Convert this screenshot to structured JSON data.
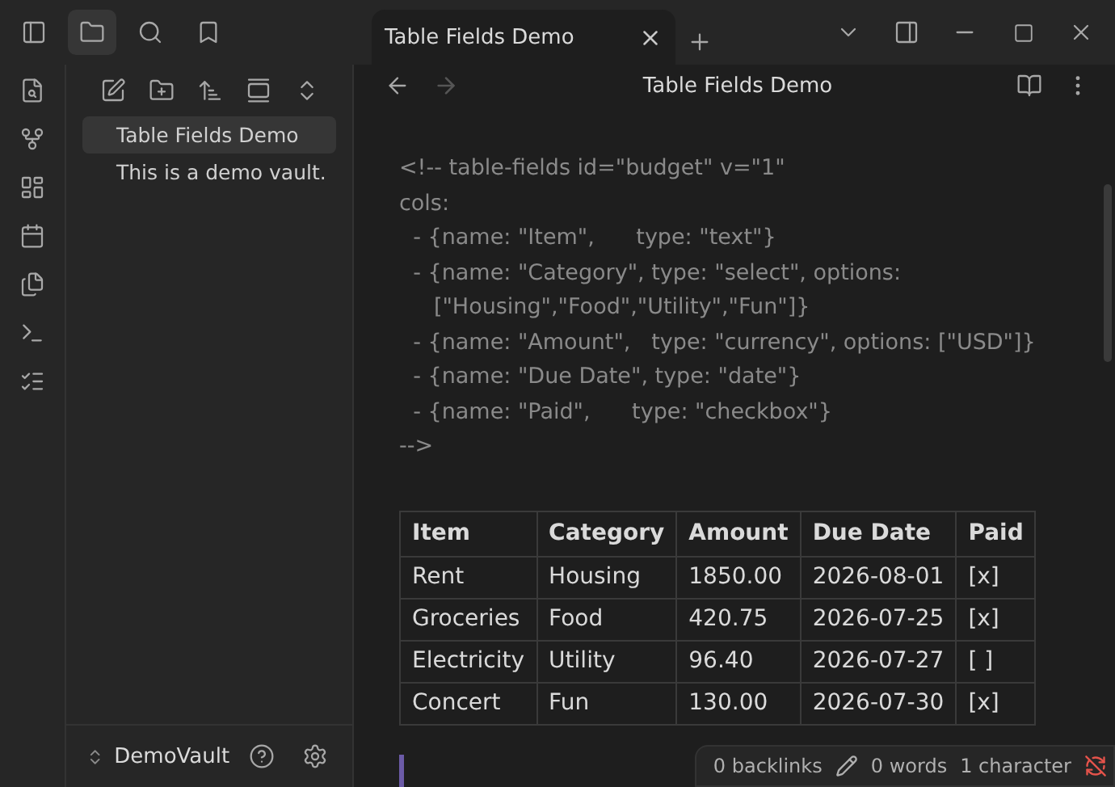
{
  "tab": {
    "title": "Table Fields Demo"
  },
  "file_tree": [
    {
      "label": "Table Fields Demo",
      "selected": true
    },
    {
      "label": "This is a demo vault.",
      "selected": false
    }
  ],
  "vault": {
    "name": "DemoVault"
  },
  "note": {
    "title": "Table Fields Demo",
    "code_lines": [
      "<!-- table-fields id=\"budget\" v=\"1\"",
      "cols:",
      "  - {name: \"Item\",      type: \"text\"}",
      "  - {name: \"Category\", type: \"select\", options:",
      "     [\"Housing\",\"Food\",\"Utility\",\"Fun\"]}",
      "  - {name: \"Amount\",   type: \"currency\", options: [\"USD\"]}",
      "  - {name: \"Due Date\", type: \"date\"}",
      "  - {name: \"Paid\",      type: \"checkbox\"}",
      "-->"
    ],
    "table": {
      "columns": [
        "Item",
        "Category",
        "Amount",
        "Due Date",
        "Paid"
      ],
      "rows": [
        [
          "Rent",
          "Housing",
          "1850.00",
          "2026-08-01",
          "[x]"
        ],
        [
          "Groceries",
          "Food",
          "420.75",
          "2026-07-25",
          "[x]"
        ],
        [
          "Electricity",
          "Utility",
          "96.40",
          "2026-07-27",
          "[ ]"
        ],
        [
          "Concert",
          "Fun",
          "130.00",
          "2026-07-30",
          "[x]"
        ]
      ]
    }
  },
  "status_bar": {
    "backlinks": "0 backlinks",
    "words": "0 words",
    "characters": "1 character"
  }
}
